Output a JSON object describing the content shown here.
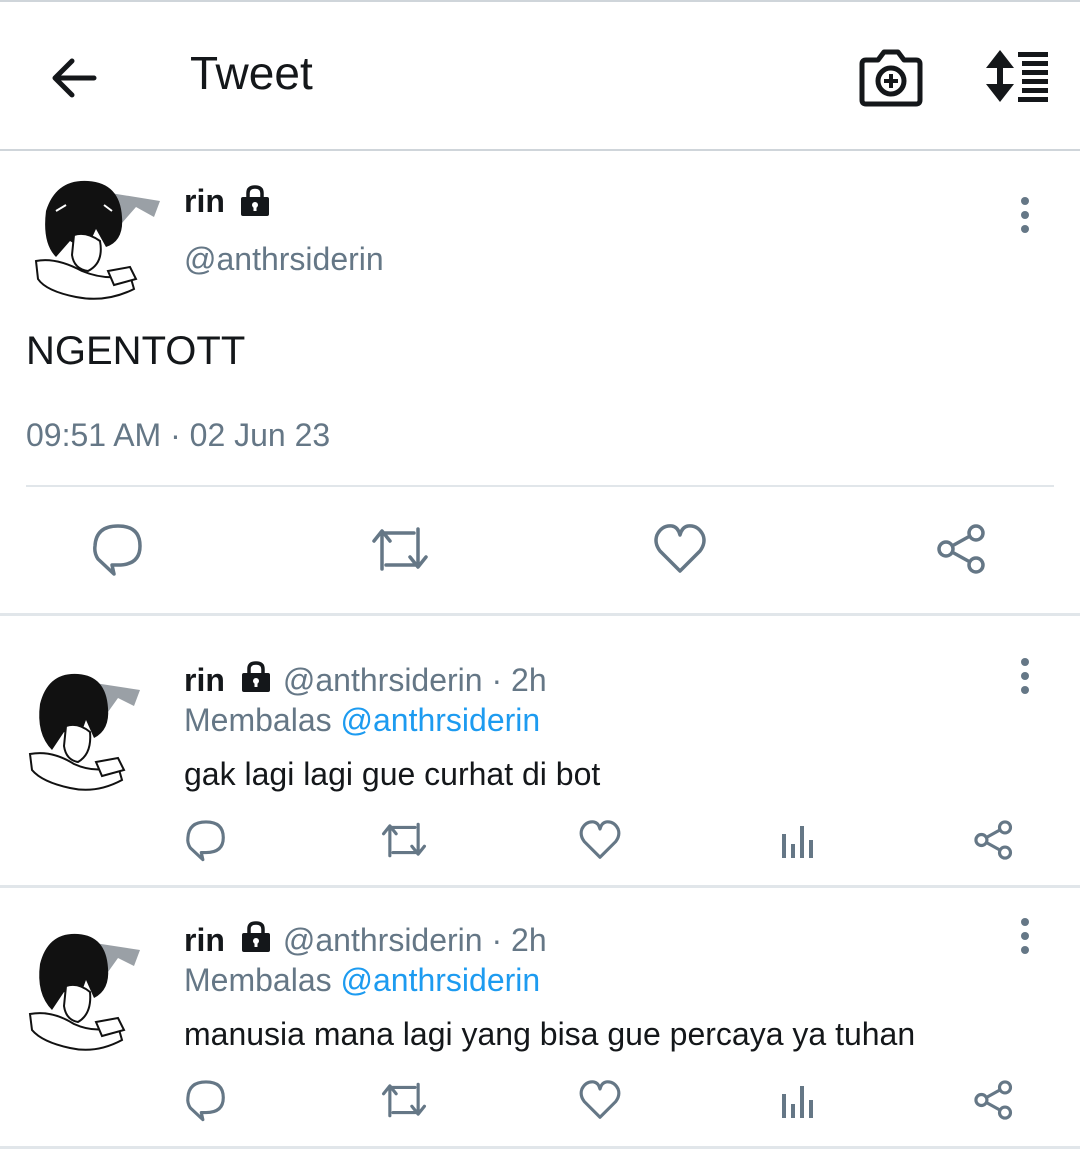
{
  "header": {
    "title": "Tweet",
    "back_icon": "back-arrow-icon",
    "camera_icon": "camera-add-icon",
    "sort_icon": "sort-order-icon"
  },
  "tweet": {
    "name": "rin",
    "handle": "@anthrsiderin",
    "text": "NGENTOTT",
    "timestamp": "09:51 AM · 02 Jun 23",
    "actions": [
      "reply-icon",
      "retweet-icon",
      "like-icon",
      "share-icon"
    ]
  },
  "replies": [
    {
      "name": "rin",
      "handle_time": "@anthrsiderin · 2h",
      "replying_label": "Membalas",
      "replying_to": "@anthrsiderin",
      "text": "gak lagi lagi gue curhat di bot"
    },
    {
      "name": "rin",
      "handle_time": "@anthrsiderin · 2h",
      "replying_label": "Membalas",
      "replying_to": "@anthrsiderin",
      "text": "manusia mana lagi yang bisa gue percaya ya tuhan"
    }
  ],
  "colors": {
    "text": "#14171a",
    "secondary": "#657786",
    "link": "#1d9bf0",
    "divider": "#e1e6ea"
  }
}
